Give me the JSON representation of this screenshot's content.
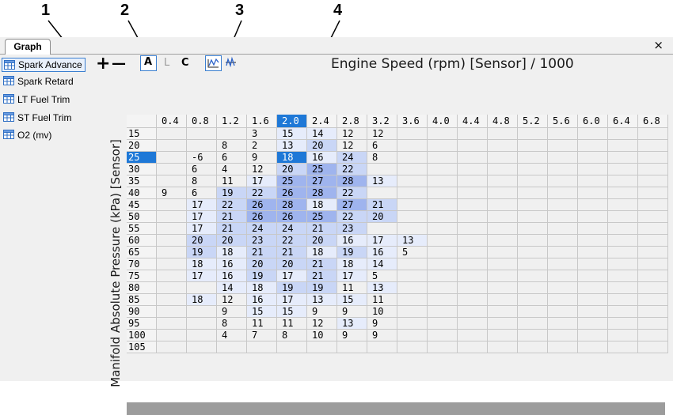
{
  "callouts": [
    "1",
    "2",
    "3",
    "4"
  ],
  "tabs": {
    "graph": "Graph",
    "close": "×"
  },
  "sidebar": {
    "items": [
      {
        "label": "Spark Advance",
        "selected": true
      },
      {
        "label": "Spark Retard",
        "selected": false
      },
      {
        "label": "LT Fuel Trim",
        "selected": false
      },
      {
        "label": "ST Fuel Trim",
        "selected": false
      },
      {
        "label": "O2 (mv)",
        "selected": false
      }
    ]
  },
  "toolbar": {
    "plus": "+",
    "minus": "—",
    "a_label": "A",
    "l_label": "L",
    "c_label": "C",
    "icons": [
      "graph-line-icon",
      "graph-split-icon"
    ]
  },
  "graph": {
    "title": "Engine Speed (rpm) [Sensor] / 1000",
    "y_label": "Manifold Absolute Pressure (kPa) [Sensor]",
    "col_headers": [
      "0.4",
      "0.8",
      "1.2",
      "1.6",
      "2.0",
      "2.4",
      "2.8",
      "3.2",
      "3.6",
      "4.0",
      "4.4",
      "4.8",
      "5.2",
      "5.6",
      "6.0",
      "6.4",
      "6.8"
    ],
    "row_headers": [
      "15",
      "20",
      "25",
      "30",
      "35",
      "40",
      "45",
      "50",
      "55",
      "60",
      "65",
      "70",
      "75",
      "80",
      "85",
      "90",
      "95",
      "100",
      "105"
    ],
    "selected_col": 4,
    "selected_row": 2,
    "rows": [
      [
        "",
        "",
        "",
        "3",
        "15",
        "14",
        "12",
        "12",
        "",
        "",
        "",
        "",
        "",
        "",
        "",
        "",
        ""
      ],
      [
        "",
        "",
        "8",
        "2",
        "13",
        "20",
        "12",
        "6",
        "",
        "",
        "",
        "",
        "",
        "",
        "",
        "",
        ""
      ],
      [
        "",
        "-6",
        "6",
        "9",
        "18",
        "16",
        "24",
        "8",
        "",
        "",
        "",
        "",
        "",
        "",
        "",
        "",
        ""
      ],
      [
        "",
        "6",
        "4",
        "12",
        "20",
        "25",
        "22",
        "",
        "",
        "",
        "",
        "",
        "",
        "",
        "",
        "",
        ""
      ],
      [
        "",
        "8",
        "11",
        "17",
        "25",
        "27",
        "28",
        "13",
        "",
        "",
        "",
        "",
        "",
        "",
        "",
        "",
        ""
      ],
      [
        "9",
        "6",
        "19",
        "22",
        "26",
        "28",
        "22",
        "",
        "",
        "",
        "",
        "",
        "",
        "",
        "",
        "",
        ""
      ],
      [
        "",
        "17",
        "22",
        "26",
        "28",
        "18",
        "27",
        "21",
        "",
        "",
        "",
        "",
        "",
        "",
        "",
        "",
        ""
      ],
      [
        "",
        "17",
        "21",
        "26",
        "26",
        "25",
        "22",
        "20",
        "",
        "",
        "",
        "",
        "",
        "",
        "",
        "",
        ""
      ],
      [
        "",
        "17",
        "21",
        "24",
        "24",
        "21",
        "23",
        "",
        "",
        "",
        "",
        "",
        "",
        "",
        "",
        "",
        ""
      ],
      [
        "",
        "20",
        "20",
        "23",
        "22",
        "20",
        "16",
        "17",
        "13",
        "",
        "",
        "",
        "",
        "",
        "",
        "",
        ""
      ],
      [
        "",
        "19",
        "18",
        "21",
        "21",
        "18",
        "19",
        "16",
        "5",
        "",
        "",
        "",
        "",
        "",
        "",
        "",
        ""
      ],
      [
        "",
        "18",
        "16",
        "20",
        "20",
        "21",
        "18",
        "14",
        "",
        "",
        "",
        "",
        "",
        "",
        "",
        "",
        ""
      ],
      [
        "",
        "17",
        "16",
        "19",
        "17",
        "21",
        "17",
        "5",
        "",
        "",
        "",
        "",
        "",
        "",
        "",
        "",
        ""
      ],
      [
        "",
        "",
        "14",
        "18",
        "19",
        "19",
        "11",
        "13",
        "",
        "",
        "",
        "",
        "",
        "",
        "",
        "",
        ""
      ],
      [
        "",
        "18",
        "12",
        "16",
        "17",
        "13",
        "15",
        "11",
        "",
        "",
        "",
        "",
        "",
        "",
        "",
        "",
        ""
      ],
      [
        "",
        "",
        "9",
        "15",
        "15",
        "9",
        "9",
        "10",
        "",
        "",
        "",
        "",
        "",
        "",
        "",
        "",
        ""
      ],
      [
        "",
        "",
        "8",
        "11",
        "11",
        "12",
        "13",
        "9",
        "",
        "",
        "",
        "",
        "",
        "",
        "",
        "",
        ""
      ],
      [
        "",
        "",
        "4",
        "7",
        "8",
        "10",
        "9",
        "9",
        "",
        "",
        "",
        "",
        "",
        "",
        "",
        "",
        ""
      ],
      [
        "",
        "",
        "",
        "",
        "",
        "",
        "",
        "",
        "",
        "",
        "",
        "",
        "",
        "",
        "",
        "",
        ""
      ]
    ],
    "colors": {
      "selected": "#1e78d7",
      "header_selected": "#1e78d7",
      "shade_light": "#e6ecfb",
      "shade_mid": "#c9d6f6",
      "shade_dark": "#9fb4ee"
    }
  }
}
